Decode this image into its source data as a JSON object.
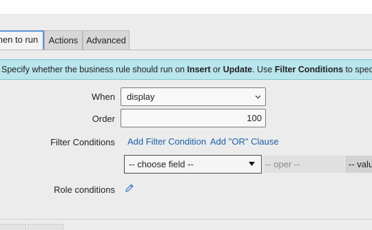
{
  "tabs": [
    {
      "label": "When to run",
      "visible_text": "hen to run",
      "active": true
    },
    {
      "label": "Actions",
      "active": false
    },
    {
      "label": "Advanced",
      "active": false
    }
  ],
  "info": {
    "text_1": "Specify whether the business rule should run on ",
    "insert": "Insert",
    "text_2": " or ",
    "update": "Update",
    "text_3": ". Use ",
    "filter_conditions": "Filter Conditions",
    "text_4": " to specify under"
  },
  "form": {
    "when_label": "When",
    "when_value": "display",
    "order_label": "Order",
    "order_value": "100",
    "filter_label": "Filter Conditions",
    "add_filter": "Add Filter Condition",
    "add_or": "Add \"OR\" Clause",
    "choose_field": "-- choose field --",
    "oper": "-- oper --",
    "value": "-- valu",
    "role_label": "Role conditions"
  },
  "icons": {
    "dropdown_chevron": "chevron-down-icon",
    "dropdown_caret": "caret-down-icon",
    "edit": "pencil-icon"
  },
  "colors": {
    "accent": "#1a5fa8",
    "info_bg": "#b9e5ec",
    "active_tab_border": "#5b8fd6"
  }
}
